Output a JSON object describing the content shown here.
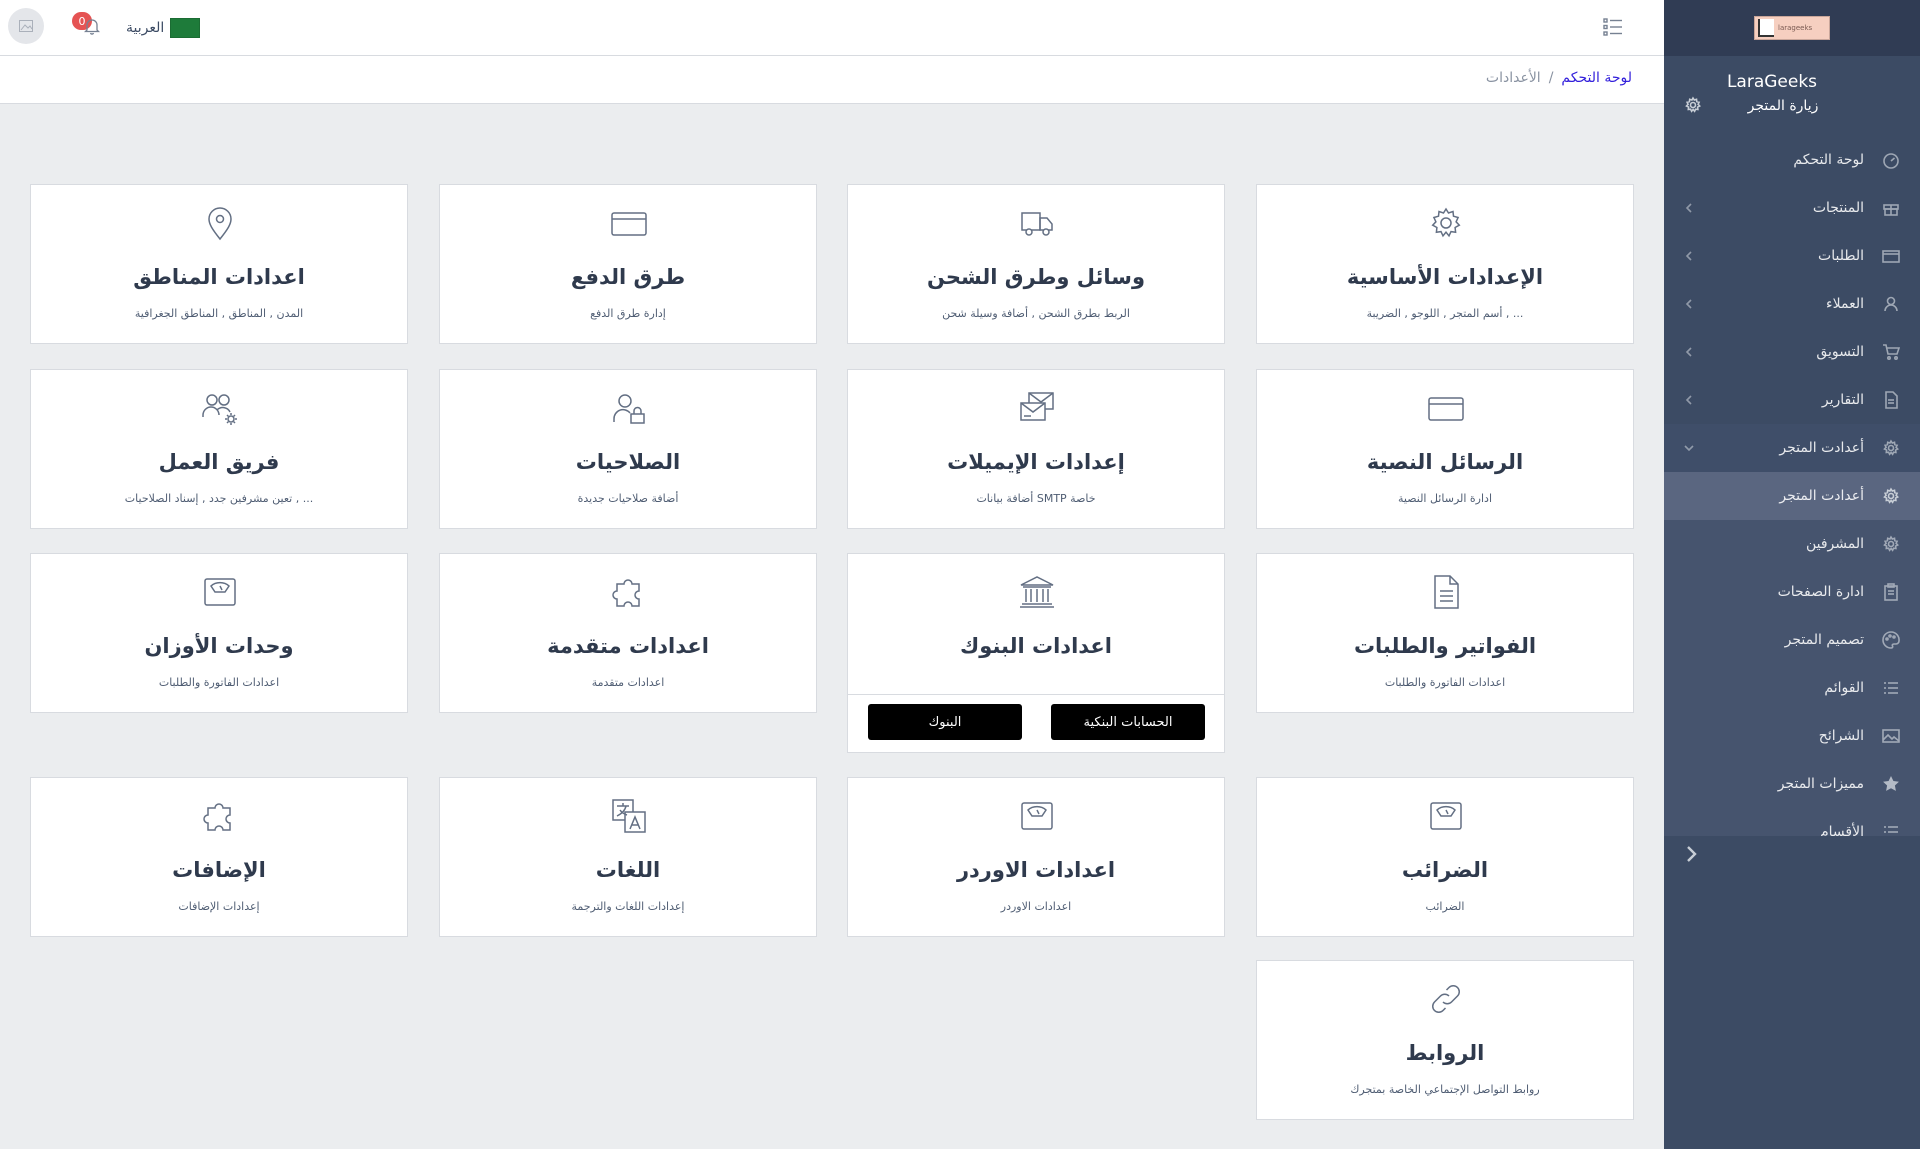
{
  "header": {
    "language": "العربية",
    "flag_text": "لا إله",
    "notifications_count": "0"
  },
  "breadcrumb": {
    "home": "لوحة التحكم",
    "separator": "/",
    "current": "الأعدادات"
  },
  "sidebar": {
    "logo_text": "larageeks",
    "store_name": "LaraGeeks",
    "visit_store": "زيارة المتجر",
    "items": [
      {
        "label": "لوحة التحكم",
        "icon": "speedometer-icon"
      },
      {
        "label": "المنتجات",
        "icon": "gift-icon",
        "chevron": true
      },
      {
        "label": "الطلبات",
        "icon": "credit-card-icon",
        "chevron": true
      },
      {
        "label": "العملاء",
        "icon": "user-icon",
        "chevron": true
      },
      {
        "label": "التسويق",
        "icon": "cart-icon",
        "chevron": true
      },
      {
        "label": "التقارير",
        "icon": "file-icon",
        "chevron": true
      },
      {
        "label": "أعدادت المتجر",
        "icon": "gear-icon",
        "chevron": true
      },
      {
        "label": "أعدادت المتجر",
        "icon": "gear-icon"
      },
      {
        "label": "المشرفين",
        "icon": "gear-icon"
      },
      {
        "label": "ادارة الصفحات",
        "icon": "clipboard-icon"
      },
      {
        "label": "تصميم المتجر",
        "icon": "palette-icon"
      },
      {
        "label": "القوائم",
        "icon": "list-icon"
      },
      {
        "label": "الشرائح",
        "icon": "image-icon"
      },
      {
        "label": "مميزات المتجر",
        "icon": "star-icon"
      },
      {
        "label": "الأقسام",
        "icon": "list-icon"
      }
    ]
  },
  "cards": [
    {
      "title": "الإعدادات الأساسية",
      "desc": "أسم المتجر , اللوجو , الضريبة , ...",
      "icon": "gear-icon"
    },
    {
      "title": "وسائل وطرق الشحن",
      "desc": "الربط بطرق الشحن , أضافة وسيلة شحن",
      "icon": "truck-icon"
    },
    {
      "title": "طرق الدفع",
      "desc": "إدارة طرق الدفع",
      "icon": "credit-card-icon"
    },
    {
      "title": "اعدادات المناطق",
      "desc": "المدن , المناطق , المناطق الجغرافية",
      "icon": "location-pin-icon"
    },
    {
      "title": "الرسائل النصية",
      "desc": "ادارة الرسائل النصية",
      "icon": "credit-card-icon"
    },
    {
      "title": "إعدادات الإيميلات",
      "desc": "أضافة بيانات SMTP خاصة",
      "icon": "envelopes-icon"
    },
    {
      "title": "الصلاحيات",
      "desc": "أضافة صلاحيات جديدة",
      "icon": "user-lock-icon"
    },
    {
      "title": "فريق العمل",
      "desc": "تعين مشرفين جدد , إسناد الصلاحيات , ...",
      "icon": "team-gear-icon"
    },
    {
      "title": "الفواتير والطلبات",
      "desc": "اعدادات الفاتورة والطلبات",
      "icon": "document-icon"
    },
    {
      "title": "اعدادات البنوك",
      "desc": "",
      "icon": "bank-icon"
    },
    {
      "title": "اعدادات متقدمة",
      "desc": "اعدادات متقدمة",
      "icon": "puzzle-icon"
    },
    {
      "title": "وحدات الأوزان",
      "desc": "اعدادات الفاتورة والطلبات",
      "icon": "scale-icon"
    },
    {
      "title": "الضرائب",
      "desc": "الضرائب",
      "icon": "scale-icon"
    },
    {
      "title": "اعدادات الاوردر",
      "desc": "اعدادات الاوردر",
      "icon": "scale-icon"
    },
    {
      "title": "اللغات",
      "desc": "إعدادات اللغات والترجمة",
      "icon": "translate-icon"
    },
    {
      "title": "الإضافات",
      "desc": "إعدادات الإضافات",
      "icon": "puzzle-icon"
    },
    {
      "title": "الروابط",
      "desc": "روابط التواصل الإجتماعي الخاصة بمتجرك",
      "icon": "link-icon"
    }
  ],
  "bank_buttons": {
    "accounts": "الحسابات البنكية",
    "banks": "البنوك"
  }
}
